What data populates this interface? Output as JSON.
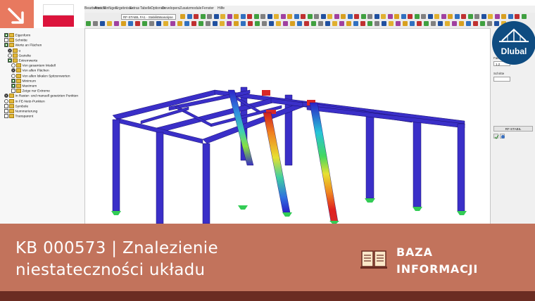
{
  "app": {
    "menu": [
      "Bearbeiten",
      "Ansicht",
      "Einfügen",
      "Ergebnisse",
      "Extras",
      "Tabelle",
      "Optionen",
      "Developers",
      "Zusatzmodule",
      "Fenster",
      "Hilfe"
    ],
    "module_combo": "RF-STABIL FA1 - Stabilitätsanalyse"
  },
  "navigator": {
    "items": [
      {
        "label": "Eigenform",
        "indent": 1,
        "check": "on",
        "icon": true
      },
      {
        "label": "Schnitte",
        "indent": 1,
        "check": "off",
        "icon": true
      },
      {
        "label": "Werte an Flächen",
        "indent": 1,
        "check": "on",
        "icon": true
      },
      {
        "label": "u",
        "indent": 2,
        "check": "radio-on",
        "icon": true
      },
      {
        "label": "Gezielte",
        "indent": 2,
        "check": "radio-off",
        "icon": true
      },
      {
        "label": "Extremwerte",
        "indent": 2,
        "check": "on",
        "icon": true
      },
      {
        "label": "Von gesamtem Modell",
        "indent": 3,
        "check": "radio-off",
        "icon": true
      },
      {
        "label": "Von allen Flächen",
        "indent": 3,
        "check": "radio-on",
        "icon": true
      },
      {
        "label": "Von allen lokalen Spitzenwerten",
        "indent": 3,
        "check": "radio-off",
        "icon": true
      },
      {
        "label": "Minimum",
        "indent": 3,
        "check": "on",
        "icon": true
      },
      {
        "label": "Maximum",
        "indent": 3,
        "check": "on",
        "icon": true
      },
      {
        "label": "Zeige nur Extreme",
        "indent": 3,
        "check": "off",
        "icon": true
      },
      {
        "label": "In Raster- und manuell gesetzten Punkten",
        "indent": 1,
        "check": "radio-on",
        "icon": true
      },
      {
        "label": "In FE-Netz-Punkten",
        "indent": 1,
        "check": "radio-off",
        "icon": true
      },
      {
        "label": "Symbole",
        "indent": 1,
        "check": "off",
        "icon": true
      },
      {
        "label": "Nummerierung",
        "indent": 1,
        "check": "off",
        "icon": true
      },
      {
        "label": "Transparent",
        "indent": 1,
        "check": "off",
        "icon": true
      }
    ]
  },
  "panel": {
    "factor_label": "Faktor",
    "factor_value": "1.2",
    "step_label": "Schritte",
    "module_button": "RF-STABIL"
  },
  "brand": {
    "logo_text": "Dlubal",
    "accent": "#c2735c",
    "dark": "#6b2c22",
    "flag_red": "#dc143c",
    "navy": "#0f4c81"
  },
  "banner": {
    "title_line1": "KB 000573 | Znalezienie",
    "title_line2": "niestateczności układu",
    "tag_line1": "BAZA",
    "tag_line2": "INFORMACJI"
  }
}
